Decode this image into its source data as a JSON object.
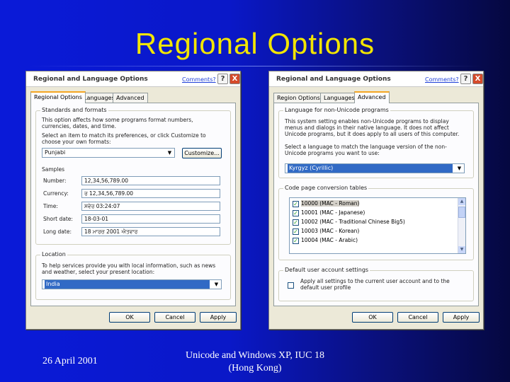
{
  "slide": {
    "title": "Regional Options",
    "footer_date": "26 April 2001",
    "footer_center_line1": "Unicode and Windows XP, IUC 18",
    "footer_center_line2": "(Hong Kong)",
    "colors": {
      "background": "#0a1ad8",
      "title": "#f2e500"
    }
  },
  "left_dialog": {
    "title": "Regional and Language Options",
    "comments": "Comments?",
    "help_label": "?",
    "close_label": "X",
    "tabs": [
      "Regional Options",
      "Languages",
      "Advanced"
    ],
    "active_tab": "Regional Options",
    "standards_group": "Standards and formats",
    "standards_desc": "This option affects how some programs format numbers, currencies, dates, and time.",
    "select_item_text": "Select an item to match its preferences, or click Customize to choose your own formats:",
    "format_value": "Punjabi",
    "customize_button": "Customize...",
    "samples_label": "Samples",
    "samples": [
      {
        "label": "Number:",
        "value": "12,34,56,789.00"
      },
      {
        "label": "Currency:",
        "value": "ਰ 12,34,56,789.00"
      },
      {
        "label": "Time:",
        "value": "ਸਵੇਰ 03:24:07"
      },
      {
        "label": "Short date:",
        "value": "18-03-01"
      },
      {
        "label": "Long date:",
        "value": "18 ਮਾਰਚ 2001 ਐਤਵਾਰ"
      }
    ],
    "location_group": "Location",
    "location_desc": "To help services provide you with local information, such as news and weather, select your present location:",
    "location_value": "India",
    "buttons": {
      "ok": "OK",
      "cancel": "Cancel",
      "apply": "Apply"
    }
  },
  "right_dialog": {
    "title": "Regional and Language Options",
    "comments": "Comments?",
    "help_label": "?",
    "close_label": "X",
    "tabs": [
      "Region Options",
      "Languages",
      "Advanced"
    ],
    "active_tab": "Advanced",
    "nonunicode_group": "Language for non-Unicode programs",
    "nonunicode_desc": "This system setting enables non-Unicode programs to display menus and dialogs in their native language. It does not affect Unicode programs, but it does apply to all users of this computer.",
    "select_lang_text": "Select a language to match the language version of the non-Unicode programs you want to use:",
    "language_value": "Kyrgyz (Cyrillic)",
    "codepage_group": "Code page conversion tables",
    "codepages": [
      "10000 (MAC - Roman)",
      "10001 (MAC - Japanese)",
      "10002 (MAC - Traditional Chinese Big5)",
      "10003 (MAC - Korean)",
      "10004 (MAC - Arabic)"
    ],
    "default_group": "Default user account settings",
    "default_checkbox": "Apply all settings to the current user account and to the default user profile",
    "buttons": {
      "ok": "OK",
      "cancel": "Cancel",
      "apply": "Apply"
    }
  }
}
